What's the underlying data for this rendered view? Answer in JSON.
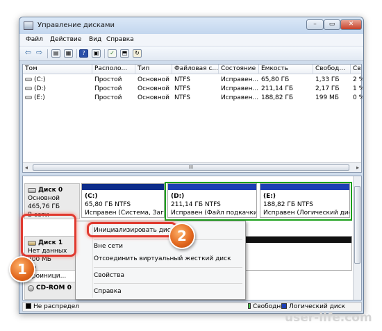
{
  "window": {
    "title": "Управление дисками"
  },
  "menu": [
    "Файл",
    "Действие",
    "Вид",
    "Справка"
  ],
  "columns": [
    "Том",
    "Располо...",
    "Тип",
    "Файловая с...",
    "Состояние",
    "Емкость",
    "Свобод...",
    "Св"
  ],
  "volumes": [
    [
      "(C:)",
      "Простой",
      "Основной",
      "NTFS",
      "Исправен...",
      "65,80 ГБ",
      "1,33 ГБ",
      "2 %"
    ],
    [
      "(D:)",
      "Простой",
      "Основной",
      "NTFS",
      "Исправен...",
      "211,14 ГБ",
      "2,17 ГБ",
      "1 %"
    ],
    [
      "(E:)",
      "Простой",
      "Основной",
      "NTFS",
      "Исправен...",
      "188,82 ГБ",
      "199 МБ",
      "0 %"
    ]
  ],
  "scroll_thumb": "III",
  "disk0": {
    "title": "Диск 0",
    "type": "Основной",
    "size": "465,76 ГБ",
    "status": "В сети",
    "partitions": [
      {
        "name": "(C:)",
        "size": "65,80 ГБ NTFS",
        "status": "Исправен (Система, Загр"
      },
      {
        "name": "(D:)",
        "size": "211,14 ГБ NTFS",
        "status": "Исправен (Файл подкачки,"
      },
      {
        "name": "(E:)",
        "size": "188,82 ГБ NTFS",
        "status": "Исправен (Логический дис"
      }
    ]
  },
  "disk1": {
    "title": "Диск 1",
    "type": "Нет данных",
    "size": "200 МБ",
    "status": "Не проиници..."
  },
  "cdrom": {
    "title": "CD-ROM 0"
  },
  "legend": {
    "unallocated": "Не распредел",
    "free": "Свободно",
    "logical": "Логический диск"
  },
  "context_menu": {
    "items": [
      "Инициализировать диск",
      "Вне сети",
      "Отсоединить виртуальный жесткий диск",
      "Свойства",
      "Справка"
    ]
  },
  "badges": [
    "1",
    "2"
  ],
  "watermark": "user-life.com",
  "colors": {
    "partition_bar": "#1c3fb5",
    "extended_border": "#1aa01a",
    "highlight": "#e03a30",
    "badge": "#e0651c"
  }
}
